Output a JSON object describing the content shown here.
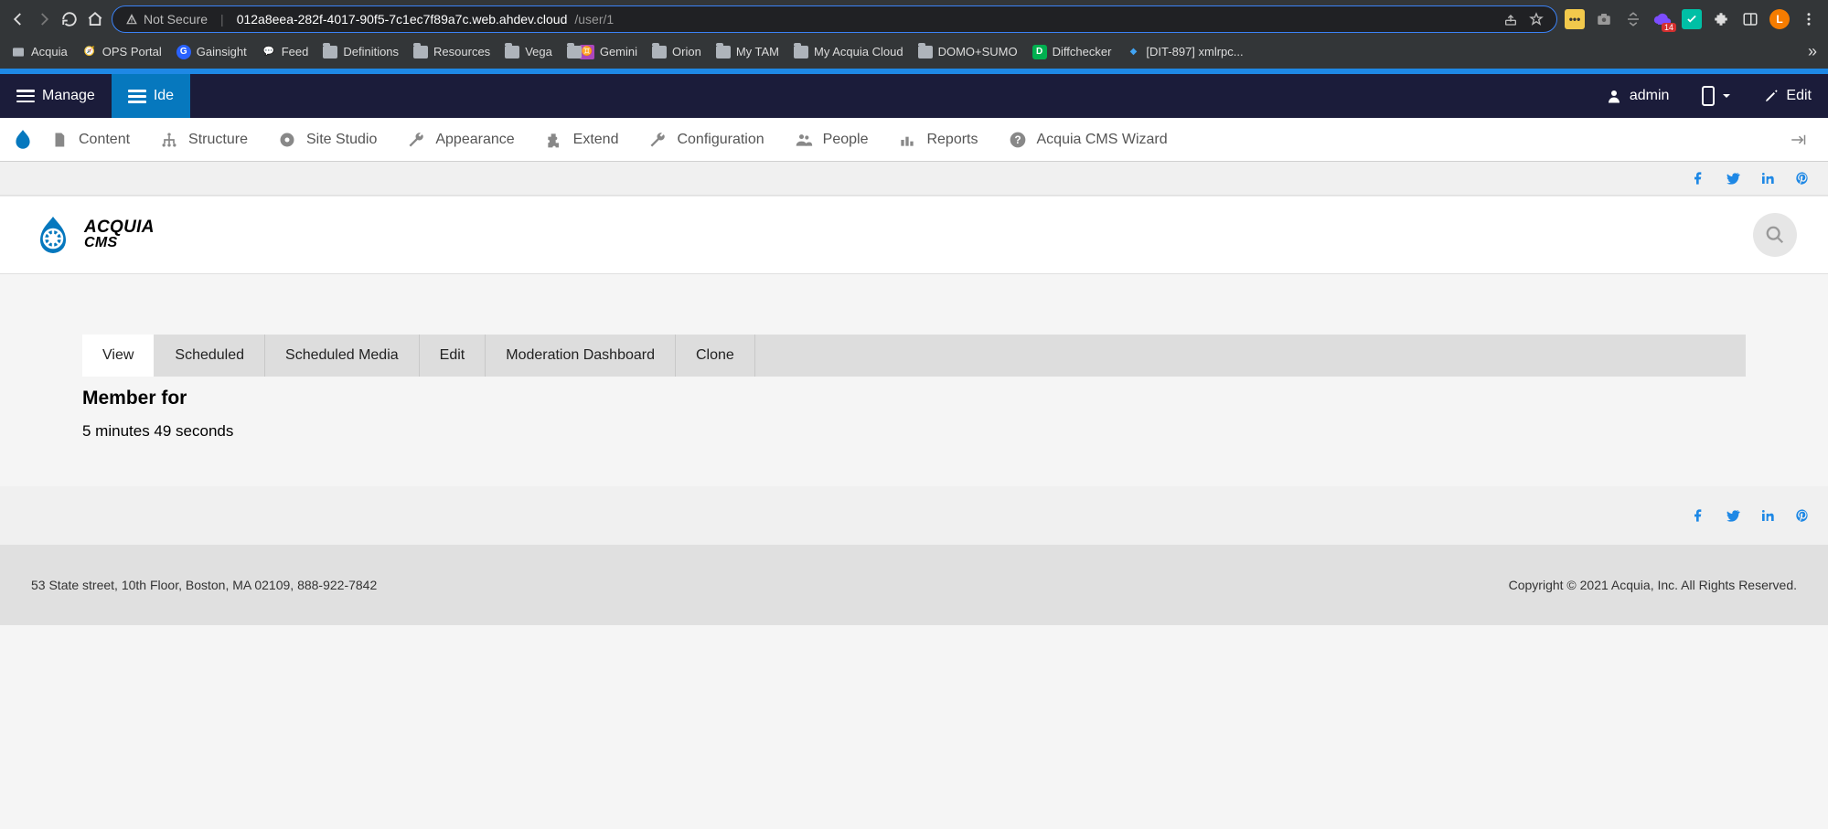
{
  "browser": {
    "not_secure": "Not Secure",
    "url_host": "012a8eea-282f-4017-90f5-7c1ec7f89a7c.web.ahdev.cloud",
    "url_path": "/user/1",
    "avatar_initial": "L",
    "badge_count": "14",
    "bookmarks": [
      {
        "label": "Acquia",
        "type": "icon"
      },
      {
        "label": "OPS Portal",
        "type": "icon"
      },
      {
        "label": "Gainsight",
        "type": "icon"
      },
      {
        "label": "Feed",
        "type": "icon"
      },
      {
        "label": "Definitions",
        "type": "folder"
      },
      {
        "label": "Resources",
        "type": "folder"
      },
      {
        "label": "Vega",
        "type": "folder"
      },
      {
        "label": "Gemini",
        "type": "folder-app"
      },
      {
        "label": "Orion",
        "type": "folder"
      },
      {
        "label": "My TAM",
        "type": "folder"
      },
      {
        "label": "My Acquia Cloud",
        "type": "folder"
      },
      {
        "label": "DOMO+SUMO",
        "type": "folder"
      },
      {
        "label": "Diffchecker",
        "type": "icon"
      },
      {
        "label": "[DIT-897] xmlrpc...",
        "type": "icon"
      }
    ]
  },
  "drupal_toolbar": {
    "manage": "Manage",
    "ide": "Ide",
    "user": "admin",
    "edit": "Edit"
  },
  "admin_menu": {
    "items": [
      "Content",
      "Structure",
      "Site Studio",
      "Appearance",
      "Extend",
      "Configuration",
      "People",
      "Reports",
      "Acquia CMS Wizard"
    ]
  },
  "brand": {
    "line1": "ACQUIA",
    "line2": "CMS"
  },
  "tabs": [
    "View",
    "Scheduled",
    "Scheduled Media",
    "Edit",
    "Moderation Dashboard",
    "Clone"
  ],
  "content": {
    "heading": "Member for",
    "value": "5 minutes 49 seconds"
  },
  "footer": {
    "address": "53 State street, 10th Floor, Boston, MA 02109, 888-922-7842",
    "copyright": "Copyright © 2021 Acquia, Inc. All Rights Reserved."
  }
}
